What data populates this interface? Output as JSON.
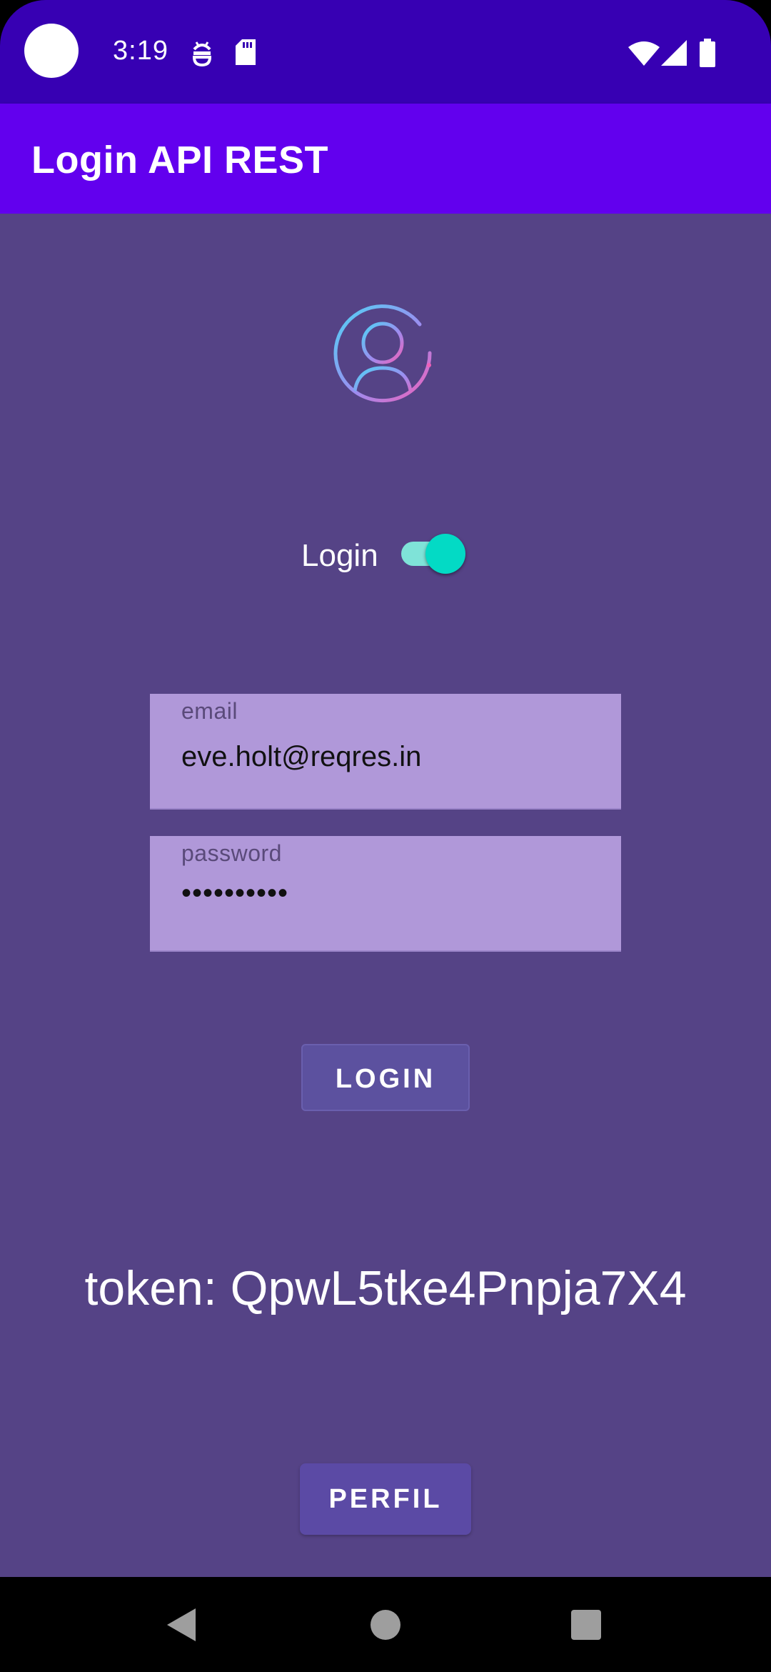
{
  "status_bar": {
    "time": "3:19",
    "left_icons": [
      "android-debug-icon",
      "sd-card-icon"
    ],
    "right_icons": [
      "wifi-icon",
      "cell-signal-icon",
      "battery-icon"
    ]
  },
  "app_bar": {
    "title": "Login API REST"
  },
  "avatar": {
    "icon": "user-circle-icon"
  },
  "login_switch": {
    "label": "Login",
    "checked": true
  },
  "email": {
    "label": "email",
    "value": "eve.holt@reqres.in"
  },
  "password": {
    "label": "password",
    "value": "••••••••••"
  },
  "login_button": {
    "label": "LOGIN"
  },
  "token": {
    "text": "token: QpwL5tke4Pnpja7X4"
  },
  "profile_button": {
    "label": "PERFIL"
  },
  "nav_bar": {
    "icons": [
      "back-icon",
      "home-icon",
      "recents-icon"
    ]
  },
  "colors": {
    "status_bar": "#3700b3",
    "app_bar": "#6200ee",
    "background": "#554386",
    "field": "#b098d9",
    "switch_thumb": "#03dac5",
    "button": "#5b4aa5"
  }
}
